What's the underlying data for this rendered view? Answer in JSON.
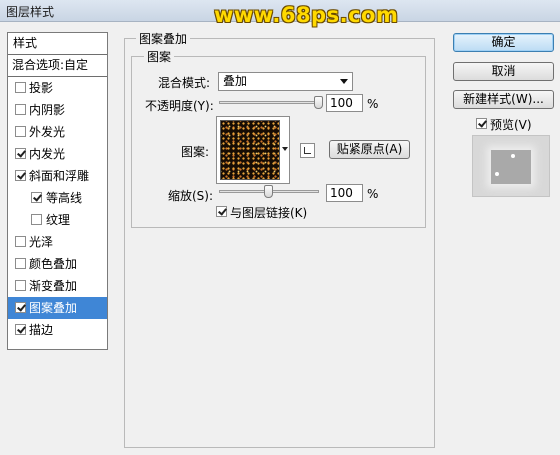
{
  "window": {
    "title": "图层样式",
    "watermark": "www.68ps.com"
  },
  "sidebar": {
    "header": "样式",
    "blend_options": "混合选项:自定",
    "items": [
      {
        "label": "投影",
        "checked": false,
        "sub": false,
        "selected": false
      },
      {
        "label": "内阴影",
        "checked": false,
        "sub": false,
        "selected": false
      },
      {
        "label": "外发光",
        "checked": false,
        "sub": false,
        "selected": false
      },
      {
        "label": "内发光",
        "checked": true,
        "sub": false,
        "selected": false
      },
      {
        "label": "斜面和浮雕",
        "checked": true,
        "sub": false,
        "selected": false
      },
      {
        "label": "等高线",
        "checked": true,
        "sub": true,
        "selected": false
      },
      {
        "label": "纹理",
        "checked": false,
        "sub": true,
        "selected": false
      },
      {
        "label": "光泽",
        "checked": false,
        "sub": false,
        "selected": false
      },
      {
        "label": "颜色叠加",
        "checked": false,
        "sub": false,
        "selected": false
      },
      {
        "label": "渐变叠加",
        "checked": false,
        "sub": false,
        "selected": false
      },
      {
        "label": "图案叠加",
        "checked": true,
        "sub": false,
        "selected": true
      },
      {
        "label": "描边",
        "checked": true,
        "sub": false,
        "selected": false
      }
    ]
  },
  "panel": {
    "group_title": "图案叠加",
    "sub_title": "图案",
    "blend_mode_label": "混合模式:",
    "blend_mode_value": "叠加",
    "opacity_label": "不透明度(Y):",
    "opacity_value": "100",
    "opacity_unit": "%",
    "opacity_level": 1.0,
    "pattern_label": "图案:",
    "snap_origin_label": "贴紧原点(A)",
    "scale_label": "缩放(S):",
    "scale_value": "100",
    "scale_unit": "%",
    "scale_level": 0.5,
    "link_label": "与图层链接(K)",
    "link_checked": true
  },
  "buttons": {
    "ok": "确定",
    "cancel": "取消",
    "new_style": "新建样式(W)...",
    "preview_label": "预览(V)",
    "preview_checked": true
  },
  "colors": {
    "selection": "#3f86d6",
    "watermark": "#ffd900",
    "primary_button": "#bcdcf4"
  }
}
